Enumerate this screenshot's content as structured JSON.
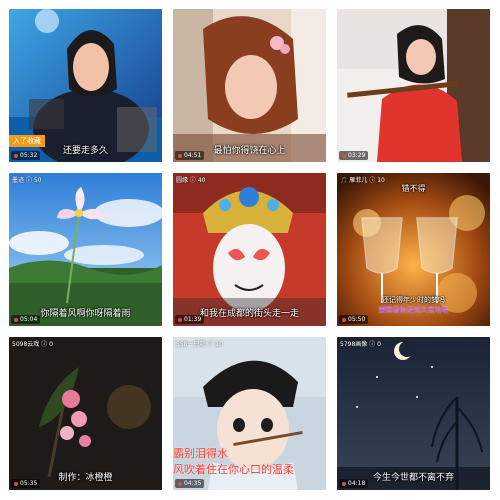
{
  "tiles": [
    {
      "time": "05:32",
      "caption": "还要走多久",
      "tag": "入了收藏",
      "top": ""
    },
    {
      "time": "04:51",
      "caption": "最怕你得饶在心上",
      "tag": "",
      "top": ""
    },
    {
      "time": "03:29",
      "caption": "",
      "tag": "",
      "top": ""
    },
    {
      "time": "05:04",
      "caption": "你隔着风啊你呀隔着雨",
      "tag": "",
      "top": "墨迹  ⓘ 50"
    },
    {
      "time": "01:39",
      "caption": "和我在成都的街头走一走",
      "tag": "",
      "top": "圆缘  ⓘ 40"
    },
    {
      "time": "05:50",
      "caption": "还记得年少时的梦吗",
      "caption2": "要跟着你走到天荒地老",
      "tag": "",
      "top": "🎵 雁菲儿  ⓘ 10",
      "top2": "错不得"
    },
    {
      "time": "05:35",
      "caption": "制作：冰橙橙",
      "tag": "",
      "top": "5098云戏  ⓘ 0"
    },
    {
      "time": "04:35",
      "caption": "霸别泪得水",
      "caption2": "风吹着住在你心口的温柔",
      "tag": "",
      "top": "558一只花  ⓘ 10"
    },
    {
      "time": "04:18",
      "caption": "今生今世都不离不弃",
      "tag": "",
      "top": "5798画像  ⓘ 0"
    }
  ],
  "colors": {
    "badge_dot": "#e24b4b",
    "orange_tag": "#f09b1a",
    "caption_red": "#ff3b2f",
    "caption_purple": "#b23cf0"
  }
}
